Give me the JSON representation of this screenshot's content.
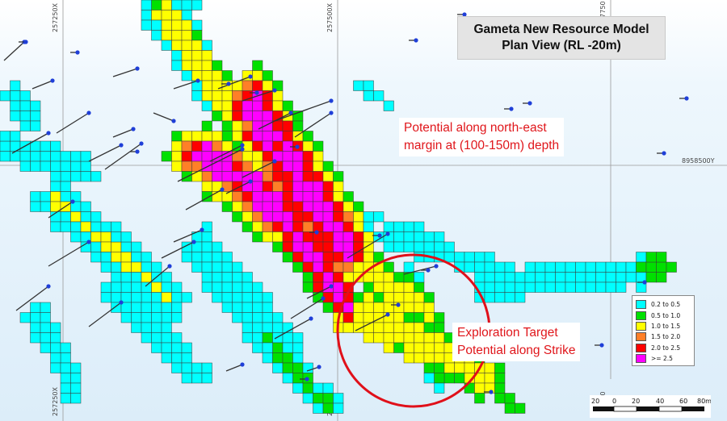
{
  "title": {
    "line1": "Gameta New Resource Model",
    "line2": "Plan View (RL -20m)"
  },
  "annotations": {
    "northeast": {
      "line1": "Potential along north-east",
      "line2": "margin at (100-150m) depth"
    },
    "strike": {
      "line1": "Exploration Target",
      "line2": "Potential along Strike"
    }
  },
  "grid_labels": {
    "x_257250": "257250X",
    "x_257500": "257500X",
    "x_257750": "257750",
    "y_8958500": "8958500Y"
  },
  "legend": {
    "items": [
      {
        "label": "0.2 to 0.5",
        "color": "#00ffff"
      },
      {
        "label": "0.5 to 1.0",
        "color": "#00e000"
      },
      {
        "label": "1.0 to 1.5",
        "color": "#ffff00"
      },
      {
        "label": "1.5 to 2.0",
        "color": "#ff7f27"
      },
      {
        "label": "2.0 to 2.5",
        "color": "#ff0000"
      },
      {
        "label": ">= 2.5",
        "color": "#ff00ff"
      }
    ]
  },
  "scale_bar": {
    "labels": [
      "20",
      "0",
      "20",
      "40",
      "60",
      "80m"
    ]
  },
  "colors": {
    "circle": "#e0101a",
    "text_red": "#e0161b",
    "collar": "#1f3fd8",
    "background_tint": "#e3f1fb"
  }
}
